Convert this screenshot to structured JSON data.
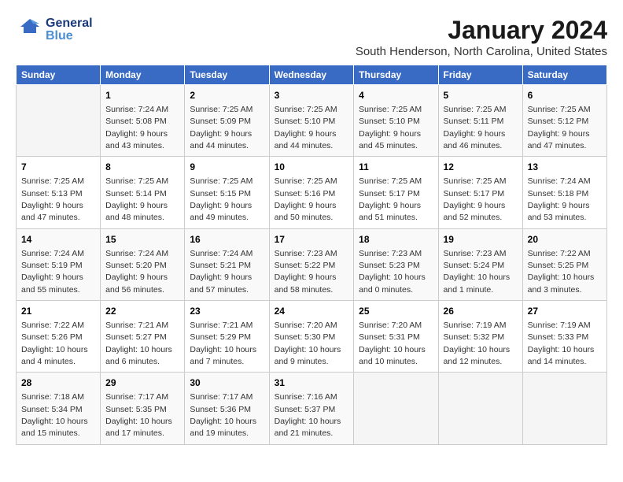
{
  "header": {
    "logo": {
      "general": "General",
      "blue": "Blue"
    },
    "title": "January 2024",
    "subtitle": "South Henderson, North Carolina, United States"
  },
  "calendar": {
    "days_of_week": [
      "Sunday",
      "Monday",
      "Tuesday",
      "Wednesday",
      "Thursday",
      "Friday",
      "Saturday"
    ],
    "weeks": [
      [
        {
          "num": "",
          "sunrise": "",
          "sunset": "",
          "daylight": ""
        },
        {
          "num": "1",
          "sunrise": "Sunrise: 7:24 AM",
          "sunset": "Sunset: 5:08 PM",
          "daylight": "Daylight: 9 hours and 43 minutes."
        },
        {
          "num": "2",
          "sunrise": "Sunrise: 7:25 AM",
          "sunset": "Sunset: 5:09 PM",
          "daylight": "Daylight: 9 hours and 44 minutes."
        },
        {
          "num": "3",
          "sunrise": "Sunrise: 7:25 AM",
          "sunset": "Sunset: 5:10 PM",
          "daylight": "Daylight: 9 hours and 44 minutes."
        },
        {
          "num": "4",
          "sunrise": "Sunrise: 7:25 AM",
          "sunset": "Sunset: 5:10 PM",
          "daylight": "Daylight: 9 hours and 45 minutes."
        },
        {
          "num": "5",
          "sunrise": "Sunrise: 7:25 AM",
          "sunset": "Sunset: 5:11 PM",
          "daylight": "Daylight: 9 hours and 46 minutes."
        },
        {
          "num": "6",
          "sunrise": "Sunrise: 7:25 AM",
          "sunset": "Sunset: 5:12 PM",
          "daylight": "Daylight: 9 hours and 47 minutes."
        }
      ],
      [
        {
          "num": "7",
          "sunrise": "Sunrise: 7:25 AM",
          "sunset": "Sunset: 5:13 PM",
          "daylight": "Daylight: 9 hours and 47 minutes."
        },
        {
          "num": "8",
          "sunrise": "Sunrise: 7:25 AM",
          "sunset": "Sunset: 5:14 PM",
          "daylight": "Daylight: 9 hours and 48 minutes."
        },
        {
          "num": "9",
          "sunrise": "Sunrise: 7:25 AM",
          "sunset": "Sunset: 5:15 PM",
          "daylight": "Daylight: 9 hours and 49 minutes."
        },
        {
          "num": "10",
          "sunrise": "Sunrise: 7:25 AM",
          "sunset": "Sunset: 5:16 PM",
          "daylight": "Daylight: 9 hours and 50 minutes."
        },
        {
          "num": "11",
          "sunrise": "Sunrise: 7:25 AM",
          "sunset": "Sunset: 5:17 PM",
          "daylight": "Daylight: 9 hours and 51 minutes."
        },
        {
          "num": "12",
          "sunrise": "Sunrise: 7:25 AM",
          "sunset": "Sunset: 5:17 PM",
          "daylight": "Daylight: 9 hours and 52 minutes."
        },
        {
          "num": "13",
          "sunrise": "Sunrise: 7:24 AM",
          "sunset": "Sunset: 5:18 PM",
          "daylight": "Daylight: 9 hours and 53 minutes."
        }
      ],
      [
        {
          "num": "14",
          "sunrise": "Sunrise: 7:24 AM",
          "sunset": "Sunset: 5:19 PM",
          "daylight": "Daylight: 9 hours and 55 minutes."
        },
        {
          "num": "15",
          "sunrise": "Sunrise: 7:24 AM",
          "sunset": "Sunset: 5:20 PM",
          "daylight": "Daylight: 9 hours and 56 minutes."
        },
        {
          "num": "16",
          "sunrise": "Sunrise: 7:24 AM",
          "sunset": "Sunset: 5:21 PM",
          "daylight": "Daylight: 9 hours and 57 minutes."
        },
        {
          "num": "17",
          "sunrise": "Sunrise: 7:23 AM",
          "sunset": "Sunset: 5:22 PM",
          "daylight": "Daylight: 9 hours and 58 minutes."
        },
        {
          "num": "18",
          "sunrise": "Sunrise: 7:23 AM",
          "sunset": "Sunset: 5:23 PM",
          "daylight": "Daylight: 10 hours and 0 minutes."
        },
        {
          "num": "19",
          "sunrise": "Sunrise: 7:23 AM",
          "sunset": "Sunset: 5:24 PM",
          "daylight": "Daylight: 10 hours and 1 minute."
        },
        {
          "num": "20",
          "sunrise": "Sunrise: 7:22 AM",
          "sunset": "Sunset: 5:25 PM",
          "daylight": "Daylight: 10 hours and 3 minutes."
        }
      ],
      [
        {
          "num": "21",
          "sunrise": "Sunrise: 7:22 AM",
          "sunset": "Sunset: 5:26 PM",
          "daylight": "Daylight: 10 hours and 4 minutes."
        },
        {
          "num": "22",
          "sunrise": "Sunrise: 7:21 AM",
          "sunset": "Sunset: 5:27 PM",
          "daylight": "Daylight: 10 hours and 6 minutes."
        },
        {
          "num": "23",
          "sunrise": "Sunrise: 7:21 AM",
          "sunset": "Sunset: 5:29 PM",
          "daylight": "Daylight: 10 hours and 7 minutes."
        },
        {
          "num": "24",
          "sunrise": "Sunrise: 7:20 AM",
          "sunset": "Sunset: 5:30 PM",
          "daylight": "Daylight: 10 hours and 9 minutes."
        },
        {
          "num": "25",
          "sunrise": "Sunrise: 7:20 AM",
          "sunset": "Sunset: 5:31 PM",
          "daylight": "Daylight: 10 hours and 10 minutes."
        },
        {
          "num": "26",
          "sunrise": "Sunrise: 7:19 AM",
          "sunset": "Sunset: 5:32 PM",
          "daylight": "Daylight: 10 hours and 12 minutes."
        },
        {
          "num": "27",
          "sunrise": "Sunrise: 7:19 AM",
          "sunset": "Sunset: 5:33 PM",
          "daylight": "Daylight: 10 hours and 14 minutes."
        }
      ],
      [
        {
          "num": "28",
          "sunrise": "Sunrise: 7:18 AM",
          "sunset": "Sunset: 5:34 PM",
          "daylight": "Daylight: 10 hours and 15 minutes."
        },
        {
          "num": "29",
          "sunrise": "Sunrise: 7:17 AM",
          "sunset": "Sunset: 5:35 PM",
          "daylight": "Daylight: 10 hours and 17 minutes."
        },
        {
          "num": "30",
          "sunrise": "Sunrise: 7:17 AM",
          "sunset": "Sunset: 5:36 PM",
          "daylight": "Daylight: 10 hours and 19 minutes."
        },
        {
          "num": "31",
          "sunrise": "Sunrise: 7:16 AM",
          "sunset": "Sunset: 5:37 PM",
          "daylight": "Daylight: 10 hours and 21 minutes."
        },
        {
          "num": "",
          "sunrise": "",
          "sunset": "",
          "daylight": ""
        },
        {
          "num": "",
          "sunrise": "",
          "sunset": "",
          "daylight": ""
        },
        {
          "num": "",
          "sunrise": "",
          "sunset": "",
          "daylight": ""
        }
      ]
    ]
  }
}
